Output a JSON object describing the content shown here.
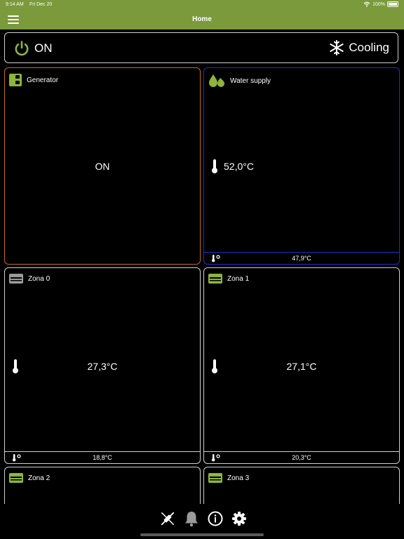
{
  "status_bar": {
    "time": "9:14 AM",
    "date": "Fri Dec 20",
    "battery": "100%"
  },
  "header": {
    "title": "Home"
  },
  "system": {
    "power_label": "ON",
    "mode_label": "Cooling"
  },
  "tiles": [
    {
      "title": "Generator",
      "value": "ON",
      "border": "#c26a1e"
    },
    {
      "title": "Water supply",
      "value": "52,0°C",
      "footer": "47,9°C",
      "border": "#1e2fc9"
    },
    {
      "title": "Zona 0",
      "value": "27,3°C",
      "footer": "18,8°C"
    },
    {
      "title": "Zona 1",
      "value": "27,1°C",
      "footer": "20,3°C"
    },
    {
      "title": "Zona 2"
    },
    {
      "title": "Zona 3"
    }
  ],
  "colors": {
    "accent": "#7a9a3c",
    "icon_green": "#8db53c",
    "inactive_gray": "#9a9a9a"
  }
}
